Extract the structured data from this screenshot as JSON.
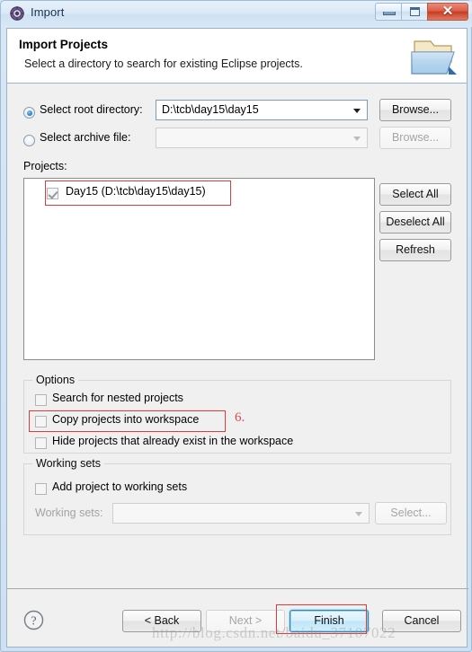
{
  "window": {
    "title": "Import",
    "icon": "eclipse-import-icon",
    "controls": {
      "minimize": "Minimize",
      "maximize": "Maximize",
      "close": "Close"
    }
  },
  "header": {
    "title": "Import Projects",
    "subtitle": "Select a directory to search for existing Eclipse projects.",
    "icon": "import-folder-icon"
  },
  "source": {
    "root_directory": {
      "label": "Select root directory:",
      "selected": true,
      "value": "D:\\tcb\\day15\\day15",
      "browse_label": "Browse...",
      "browse_enabled": true
    },
    "archive_file": {
      "label": "Select archive file:",
      "selected": false,
      "value": "",
      "browse_label": "Browse...",
      "browse_enabled": false
    }
  },
  "projects": {
    "label": "Projects:",
    "items": [
      {
        "label": "Day15 (D:\\tcb\\day15\\day15)",
        "checked": true
      }
    ],
    "buttons": {
      "select_all": "Select All",
      "deselect_all": "Deselect All",
      "refresh": "Refresh"
    }
  },
  "options": {
    "title": "Options",
    "items": [
      {
        "label": "Search for nested projects",
        "checked": false
      },
      {
        "label": "Copy projects into workspace",
        "checked": false
      },
      {
        "label": "Hide projects that already exist in the workspace",
        "checked": false
      }
    ]
  },
  "working_sets": {
    "title": "Working sets",
    "add_checkbox": {
      "label": "Add project to working sets",
      "checked": false
    },
    "field_label": "Working sets:",
    "field_value": "",
    "select_label": "Select...",
    "enabled": false
  },
  "footer": {
    "help_icon": "help-icon",
    "back": "< Back",
    "next": "Next >",
    "finish": "Finish",
    "cancel": "Cancel",
    "next_enabled": false,
    "finish_is_default": true
  },
  "annotations": {
    "step_number": "6.",
    "color": "#e03b3b"
  },
  "watermark": "http://blog.csdn.net/baidu_37107022"
}
